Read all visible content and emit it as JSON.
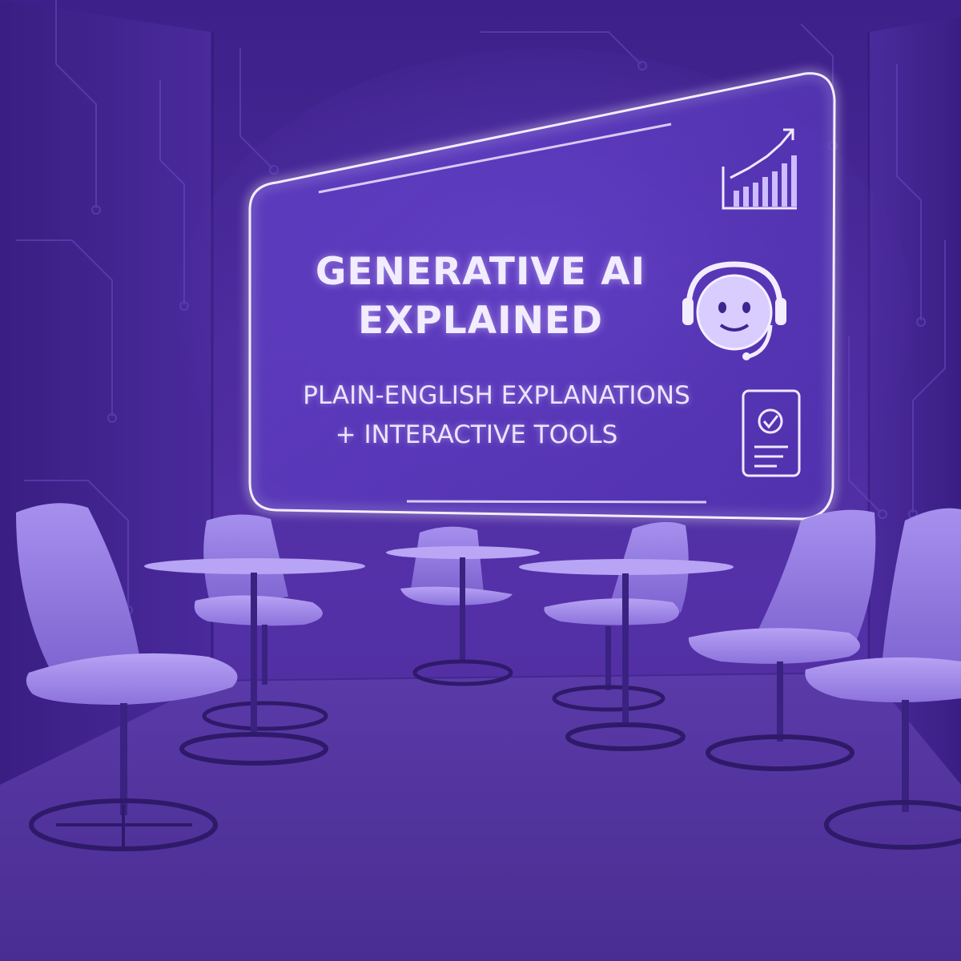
{
  "screen": {
    "title_line1": "GENERATIVE AI",
    "title_line2": "EXPLAINED",
    "subtitle_line1": "PLAIN-ENGLISH EXPLANATIONS",
    "subtitle_line2": "+ INTERACTIVE TOOLS",
    "icons": [
      "bar-chart-icon",
      "headset-robot-icon",
      "checklist-document-icon"
    ]
  },
  "colors": {
    "wall": "#4a2a9c",
    "floor": "#5a3aa6",
    "neon": "#efe6ff",
    "furniture": "#9a82e6"
  }
}
